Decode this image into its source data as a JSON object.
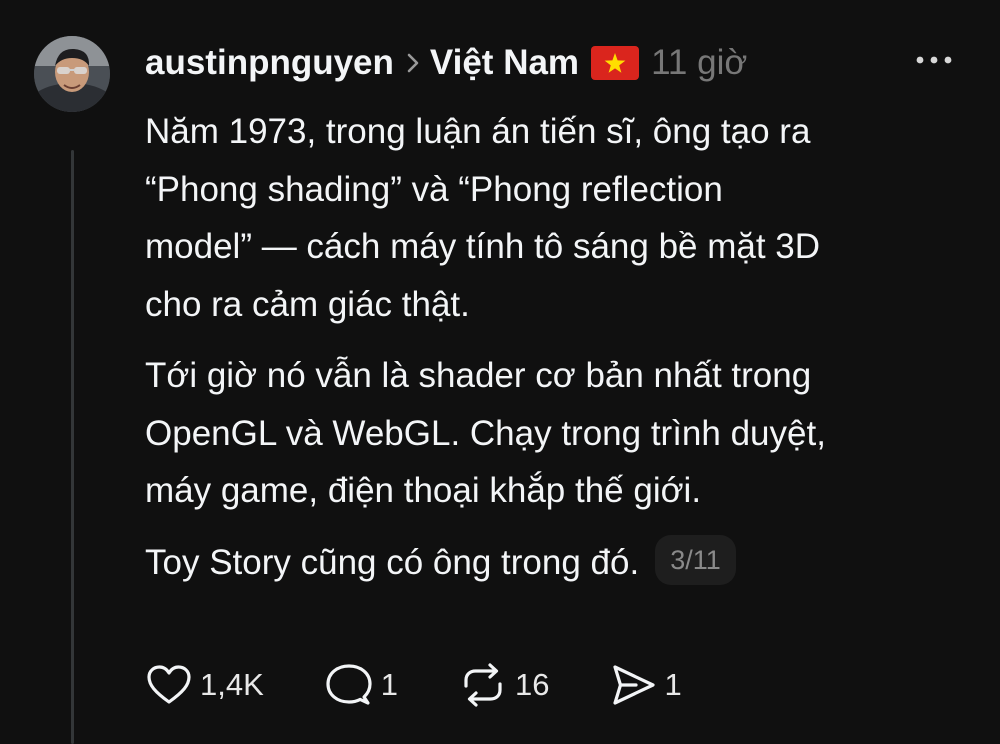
{
  "post": {
    "author": "austinpnguyen",
    "topic": "Việt Nam",
    "time": "11 giờ",
    "paragraphs": [
      {
        "lines": [
          "Năm 1973, trong luận án tiến sĩ, ông tạo ra",
          "“Phong shading” và “Phong reflection",
          "model” — cách máy tính tô sáng bề mặt 3D",
          "cho ra cảm giác thật."
        ]
      },
      {
        "lines": [
          "Tới giờ nó vẫn là shader cơ bản nhất trong",
          "OpenGL và WebGL. Chạy trong trình duyệt,",
          "máy game, điện thoại khắp thế giới."
        ]
      },
      {
        "lines": [
          "Toy Story cũng có ông trong đó."
        ]
      }
    ],
    "thread_counter": "3/11"
  },
  "actions": {
    "likes": "1,4K",
    "replies": "1",
    "reposts": "16",
    "shares": "1"
  },
  "icons": {
    "header": [
      "chevron-right-icon",
      "vietnam-flag-icon",
      "more-options-icon"
    ],
    "actions": [
      "heart-icon",
      "comment-icon",
      "repost-icon",
      "share-icon"
    ]
  },
  "colors": {
    "background": "#101010",
    "text": "#f3f5f7",
    "muted": "#777777",
    "flag_red": "#da251d",
    "flag_star": "#ffde00"
  }
}
